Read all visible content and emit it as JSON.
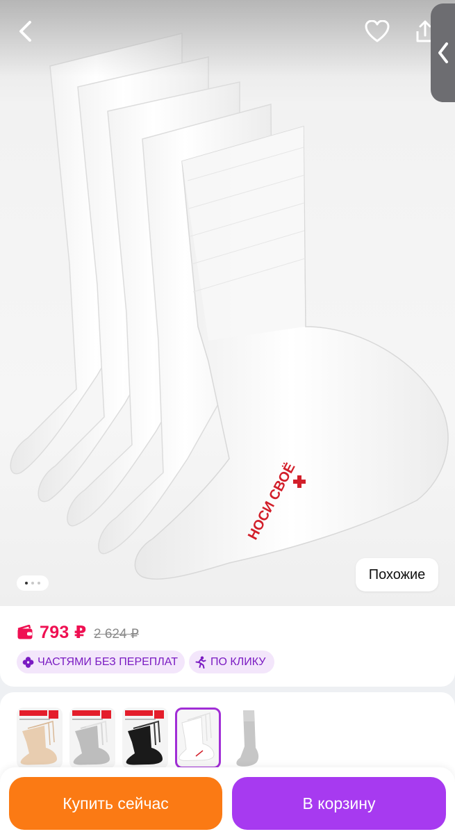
{
  "header": {
    "back_icon": "chevron-left-icon",
    "favorite_icon": "heart-icon",
    "share_icon": "share-icon",
    "side_tab_icon": "chevron-left-icon"
  },
  "gallery": {
    "product_print": "НОСИ СВОЁ",
    "slide_count": 3,
    "active_slide": 1,
    "similar_label": "Похожие"
  },
  "price": {
    "current": "793 ₽",
    "old": "2 624 ₽",
    "accent_color": "#ef1052"
  },
  "chips": {
    "installments": "ЧАСТЯМИ БЕЗ ПЕРЕПЛАТ",
    "one_click": "ПО КЛИКУ",
    "chip_color": "#7a1bc2"
  },
  "variants": [
    {
      "name": "beige",
      "color": "#e8cdb0"
    },
    {
      "name": "grey",
      "color": "#bdbdbd"
    },
    {
      "name": "black",
      "color": "#1a1a1a"
    },
    {
      "name": "white",
      "color": "#ffffff",
      "selected": true
    },
    {
      "name": "grey-single",
      "color": "#c6c6c6"
    }
  ],
  "actions": {
    "buy_now": "Купить сейчас",
    "add_to_cart": "В корзину",
    "buy_color": "#fb7a14",
    "cart_color": "#a73af0"
  }
}
